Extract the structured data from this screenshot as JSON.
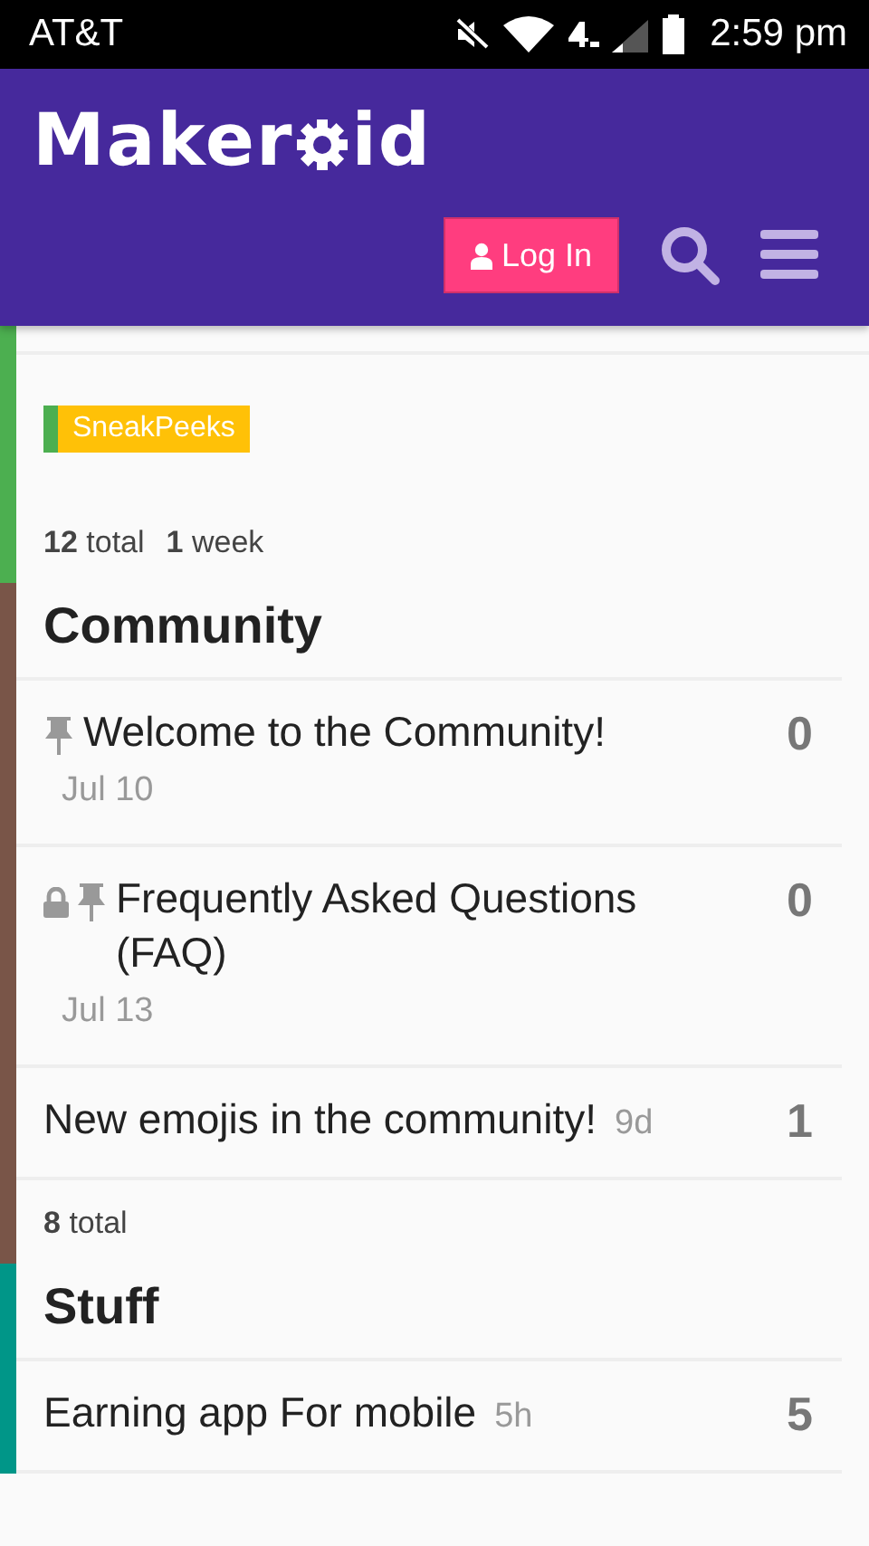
{
  "status_bar": {
    "carrier": "AT&T",
    "time": "2:59 pm"
  },
  "header": {
    "logo_start": "Maker",
    "logo_end": "id",
    "login_button": "Log In"
  },
  "sections": [
    {
      "color": "#4caf50",
      "subcategories": [
        {
          "name": "SneakPeeks",
          "color": "#ffc107"
        }
      ],
      "stats": [
        "**12** total",
        "**1** week"
      ]
    },
    {
      "color": "#795548",
      "title": "Community",
      "topics": [
        {
          "title": "Welcome to the Community!",
          "date": "Jul 10",
          "replies": "0",
          "pinned": true,
          "locked": false
        },
        {
          "title": "Frequently Asked Questions (FAQ)",
          "date": "Jul 13",
          "replies": "0",
          "pinned": true,
          "locked": true
        },
        {
          "title": "New emojis in the community!",
          "date": "9d",
          "replies": "1",
          "pinned": false,
          "locked": false
        }
      ],
      "stats": [
        "**8** total"
      ]
    },
    {
      "color": "#009688",
      "title": "Stuff",
      "topics": [
        {
          "title": "Earning app For mobile",
          "date": "5h",
          "replies": "5",
          "pinned": false,
          "locked": false
        }
      ]
    }
  ]
}
